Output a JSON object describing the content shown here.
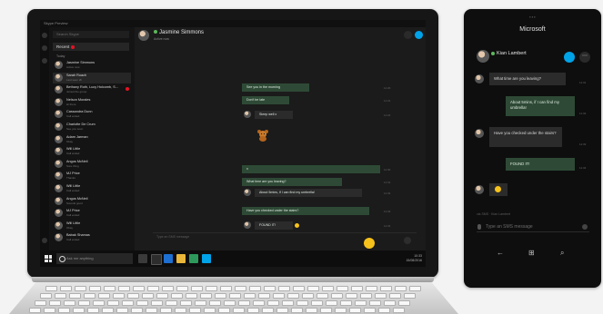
{
  "laptop": {
    "window_title": "Skype Preview",
    "sidebar": {
      "search_placeholder": "Search Skype",
      "recent_label": "Recent",
      "section_label": "Today",
      "contacts": [
        {
          "name": "Jasmine Simmons",
          "sub": "Active now",
          "active": false,
          "badge": false
        },
        {
          "name": "Sarah Roach",
          "sub": "Last seen 2h",
          "active": true,
          "badge": false
        },
        {
          "name": "Bethany Roth, Lucy Holcomb, S...",
          "sub": "Joined the group",
          "active": false,
          "badge": true
        },
        {
          "name": "Nelson Morales",
          "sub": "Hi there",
          "active": false,
          "badge": false
        },
        {
          "name": "Cassandra Dunn",
          "sub": "Call ended",
          "active": false,
          "badge": false
        },
        {
          "name": "Charlotte De Crum",
          "sub": "See you soon",
          "active": false,
          "badge": false
        },
        {
          "name": "Adam Jarman",
          "sub": "Okay",
          "active": false,
          "badge": false
        },
        {
          "name": "Will Little",
          "sub": "Call ended",
          "active": false,
          "badge": false
        },
        {
          "name": "Angus McNeil",
          "sub": "Sure thing",
          "active": false,
          "badge": false
        },
        {
          "name": "MJ Price",
          "sub": "Thanks",
          "active": false,
          "badge": false
        },
        {
          "name": "Will Little",
          "sub": "Call ended",
          "active": false,
          "badge": false
        },
        {
          "name": "Angus McNeil",
          "sub": "Sounds good",
          "active": false,
          "badge": false
        },
        {
          "name": "MJ Price",
          "sub": "Call ended",
          "active": false,
          "badge": false
        },
        {
          "name": "Will Little",
          "sub": "Okay",
          "active": false,
          "badge": false
        },
        {
          "name": "Babak Shamas",
          "sub": "Call ended",
          "active": false,
          "badge": false
        }
      ]
    },
    "chat": {
      "contact_name": "Jasmine Simmons",
      "contact_status": "Active now",
      "messages": [
        {
          "text": "See you in the morning",
          "dir": "out",
          "ts": "11:20"
        },
        {
          "text": "Don't be late",
          "dir": "out",
          "ts": "11:21"
        },
        {
          "text": "Sleep well x",
          "dir": "in",
          "ts": "11:22"
        },
        {
          "text": "x",
          "dir": "out",
          "ts": "11:30"
        },
        {
          "text": "What time are you leaving?",
          "dir": "out",
          "ts": "11:31"
        },
        {
          "text": "About 5mins, if I can find my umbrella!",
          "dir": "in",
          "ts": "11:32"
        },
        {
          "text": "Have you checked under the stairs?",
          "dir": "out",
          "ts": "11:33"
        },
        {
          "text": "FOUND IT!",
          "dir": "in",
          "ts": "11:34"
        }
      ],
      "composer_placeholder": "Type an SMS message"
    },
    "taskbar": {
      "search_placeholder": "Ask me anything",
      "time": "10:33",
      "date": "15/08/2016"
    }
  },
  "phone": {
    "app_title": "Microsoft",
    "contact_name": "Kian Lambert",
    "messages": [
      {
        "text": "What time are you leaving?",
        "dir": "in",
        "ts": "11:31"
      },
      {
        "text": "About 5mins, if I can find my umbrella!",
        "dir": "out",
        "ts": "11:32"
      },
      {
        "text": "Have you checked under the stairs?",
        "dir": "in",
        "ts": "11:33"
      },
      {
        "text": "FOUND IT!",
        "dir": "out",
        "ts": "11:34"
      }
    ],
    "typing_label": "via SMS · Kian Lambert",
    "input_placeholder": "Type an SMS message",
    "colors": {
      "accent": "#00a2e8",
      "outgoing_bubble": "#2e4a36",
      "incoming_bubble": "#2b2b2b"
    }
  }
}
